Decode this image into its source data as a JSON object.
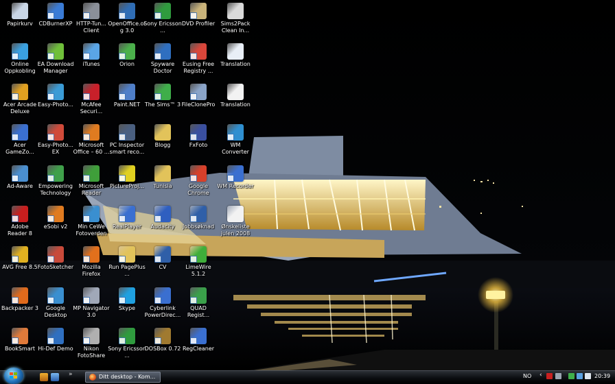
{
  "desktop": {
    "icons": [
      {
        "label": "Papirkurv",
        "color": "#c9d6e6"
      },
      {
        "label": "CDBurnerXP",
        "color": "#3a7bd5"
      },
      {
        "label": "HTTP-Tun... Client",
        "color": "#8a8f99"
      },
      {
        "label": "OpenOffice.org 3.0",
        "color": "#2f6db5"
      },
      {
        "label": "Sony Ericsson ...",
        "color": "#2f9b3e"
      },
      {
        "label": "DVD Profiler",
        "color": "#c9b37a"
      },
      {
        "label": "Sims2Pack Clean In...",
        "color": "#d9d9d9"
      },
      {
        "label": "Online Oppkobling",
        "color": "#3aa0e0"
      },
      {
        "label": "EA Download Manager",
        "color": "#6fbf3a"
      },
      {
        "label": "iTunes",
        "color": "#5aa5e6"
      },
      {
        "label": "Orion",
        "color": "#4bb04b"
      },
      {
        "label": "Spyware Doctor",
        "color": "#2f6fc0"
      },
      {
        "label": "Eusing Free Registry ...",
        "color": "#d9463a"
      },
      {
        "label": "Translation",
        "color": "#e8eef6"
      },
      {
        "label": "Acer Arcade Deluxe",
        "color": "#e0a020"
      },
      {
        "label": "Easy-Photo...",
        "color": "#3a9bd5"
      },
      {
        "label": "McAfee Securi...",
        "color": "#c8202a"
      },
      {
        "label": "Paint.NET",
        "color": "#4f7fc8"
      },
      {
        "label": "The Sims™ 3",
        "color": "#3fae4a"
      },
      {
        "label": "FileClonePro",
        "color": "#8aa4c8"
      },
      {
        "label": "Translation",
        "color": "#f2f2f2"
      },
      {
        "label": "Acer GameZo...",
        "color": "#3a6fd0"
      },
      {
        "label": "Easy-Photo... EX",
        "color": "#d04a3a"
      },
      {
        "label": "Microsoft Office – 60 ...",
        "color": "#e07b20"
      },
      {
        "label": "PC Inspector smart reco...",
        "color": "#4a5f80"
      },
      {
        "label": "Blogg",
        "color": "#e2c35a"
      },
      {
        "label": "FxFoto",
        "color": "#3a4fa0"
      },
      {
        "label": "WM Converter",
        "color": "#2f8fd0"
      },
      {
        "label": "Ad-Aware",
        "color": "#4a8fd0"
      },
      {
        "label": "Empowering Technology",
        "color": "#3fa04a"
      },
      {
        "label": "Microsoft Reader",
        "color": "#3f9f3a"
      },
      {
        "label": "PictureProj...",
        "color": "#e0d020"
      },
      {
        "label": "Tunisia",
        "color": "#e2c35a"
      },
      {
        "label": "Google Chrome",
        "color": "#d8402a"
      },
      {
        "label": "WM Recorder",
        "color": "#3a6fd0"
      },
      {
        "label": "Adobe Reader 8",
        "color": "#c81e1e"
      },
      {
        "label": "eSobi v2",
        "color": "#e07b20"
      },
      {
        "label": "Min CeWe Fotoverden",
        "color": "#3a8fd0"
      },
      {
        "label": "RealPlayer",
        "color": "#3a6fd0"
      },
      {
        "label": "Audacity",
        "color": "#2f5fc0"
      },
      {
        "label": "Jobbsøknad",
        "color": "#2f5fa8"
      },
      {
        "label": "Ønskeliste julen 2008",
        "color": "#f2f2f2"
      },
      {
        "label": "AVG Free 8.5",
        "color": "#e0b020"
      },
      {
        "label": "FotoSketcher",
        "color": "#c84a3a"
      },
      {
        "label": "Mozilla Firefox",
        "color": "#e2701c"
      },
      {
        "label": "Run PagePlus ...",
        "color": "#e2c35a"
      },
      {
        "label": "CV",
        "color": "#2f5fa8"
      },
      {
        "label": "LimeWire 5.1.2",
        "color": "#3fae3a"
      },
      {
        "label": "Backpacker 3",
        "color": "#e06a1c"
      },
      {
        "label": "Google Desktop",
        "color": "#3a8fd0"
      },
      {
        "label": "MP Navigator 3.0",
        "color": "#a0a8b8"
      },
      {
        "label": "Skype",
        "color": "#1fa0e0"
      },
      {
        "label": "Cyberlink PowerDirec...",
        "color": "#3a6fd0"
      },
      {
        "label": "QUAD Regist...",
        "color": "#3aa04a"
      },
      {
        "label": "BookSmart",
        "color": "#e07a3a"
      },
      {
        "label": "Hi-Def Demo",
        "color": "#2f6fc0"
      },
      {
        "label": "Nikon FotoShare",
        "color": "#b0b0b0"
      },
      {
        "label": "Sony Ericsson ...",
        "color": "#2f9b3e"
      },
      {
        "label": "DOSBox 0.72",
        "color": "#a07a30"
      },
      {
        "label": "RegCleaner",
        "color": "#3a6fd0"
      }
    ]
  },
  "taskbar": {
    "task_label": "Ditt desktop - Kom...",
    "quick_launch_more": "»",
    "language": "NO",
    "tray_chevron": "‹",
    "clock": "20:39"
  }
}
